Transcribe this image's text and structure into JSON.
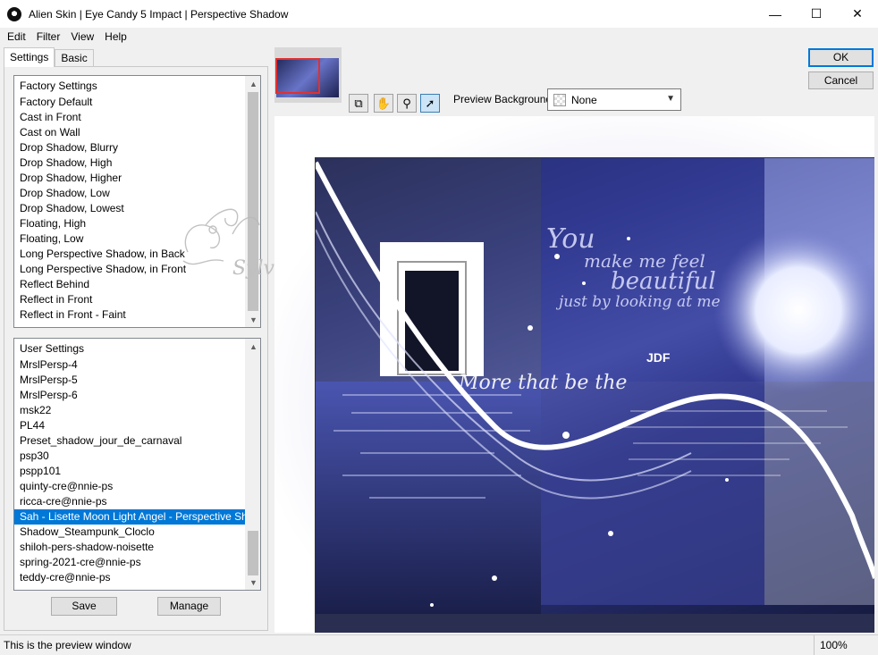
{
  "window": {
    "title": "Alien Skin | Eye Candy 5 Impact | Perspective Shadow",
    "minimize": "—",
    "maximize": "☐",
    "close": "✕"
  },
  "menu": [
    "Edit",
    "Filter",
    "View",
    "Help"
  ],
  "tabs": [
    "Settings",
    "Basic"
  ],
  "factory_settings": {
    "header": "Factory Settings",
    "items": [
      "Factory Default",
      "Cast in Front",
      "Cast on Wall",
      "Drop Shadow, Blurry",
      "Drop Shadow, High",
      "Drop Shadow, Higher",
      "Drop Shadow, Low",
      "Drop Shadow, Lowest",
      "Floating, High",
      "Floating, Low",
      "Long Perspective Shadow, in Back",
      "Long Perspective Shadow, in Front",
      "Reflect Behind",
      "Reflect in Front",
      "Reflect in Front - Faint"
    ]
  },
  "user_settings": {
    "header": "User Settings",
    "items": [
      "MrslPersp-4",
      "MrslPersp-5",
      "MrslPersp-6",
      "msk22",
      "PL44",
      "Preset_shadow_jour_de_carnaval",
      "psp30",
      "pspp101",
      "quinty-cre@nnie-ps",
      "ricca-cre@nnie-ps",
      "Sah - Lisette Moon Light Angel - Perspective Shadow",
      "Shadow_Steampunk_Cloclo",
      "shiloh-pers-shadow-noisette",
      "spring-2021-cre@nnie-ps",
      "teddy-cre@nnie-ps"
    ],
    "selected_index": 10
  },
  "buttons": {
    "save": "Save",
    "manage": "Manage",
    "ok": "OK",
    "cancel": "Cancel"
  },
  "watermark": "Sylviane",
  "preview": {
    "background_label": "Preview Background:",
    "background_value": "None",
    "tools": [
      "preview-toggle-icon",
      "hand-icon",
      "zoom-icon",
      "arrow-pointer-icon"
    ]
  },
  "artwork": {
    "script_lines": [
      "You",
      "make me feel",
      "beautiful",
      "just by looking at me"
    ],
    "jdf": "JDF",
    "wave_text": "More that be the"
  },
  "status": {
    "text": "This is the preview window",
    "zoom": "100%"
  },
  "colors": {
    "selection": "#0078d7",
    "ok_border": "#0078d7",
    "art_blue": "#3b4494"
  }
}
